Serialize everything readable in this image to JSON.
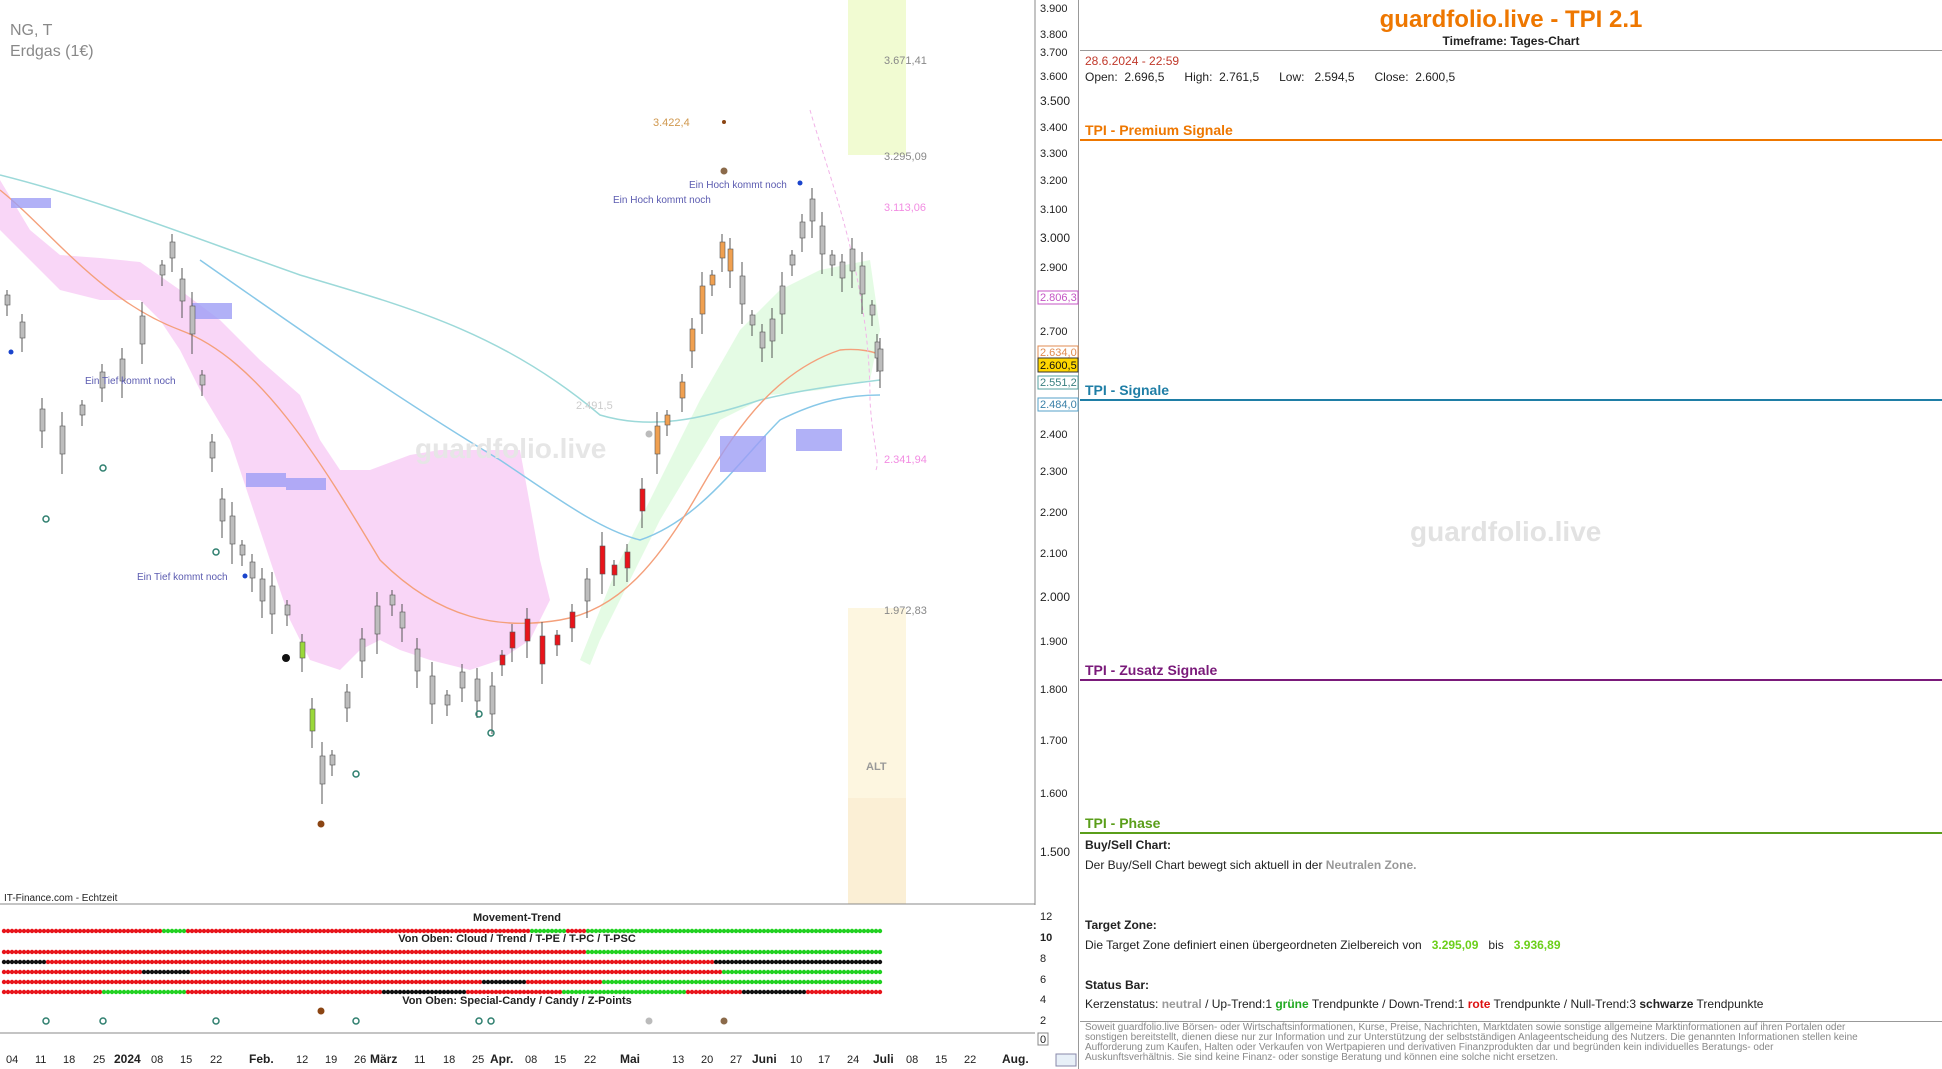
{
  "chart": {
    "symbol": "NG, T",
    "name": "Erdgas (1€)",
    "source": "IT-Finance.com - Echtzeit",
    "watermark": "guardfolio.live",
    "alt_label": "ALT",
    "price_labels": {
      "l3900": "3.900",
      "l3800": "3.800",
      "l3700": "3.700",
      "l3600": "3.600",
      "l3500": "3.500",
      "l3400": "3.400",
      "l3300": "3.300",
      "l3200": "3.200",
      "l3100": "3.100",
      "l3000": "3.000",
      "l2900": "2.900",
      "l2700": "2.700",
      "l2400": "2.400",
      "l2300": "2.300",
      "l2200": "2.200",
      "l2100": "2.100",
      "l2000": "2.000",
      "l1900": "1.900",
      "l1800": "1.800",
      "l1700": "1.700",
      "l1600": "1.600",
      "l1500": "1.500"
    },
    "price_tags": {
      "t1": "2.806,3",
      "t2": "2.634,0",
      "t3": "2.600,5",
      "t4": "2.551,2",
      "t5": "2.484,0"
    },
    "target_levels": {
      "z1": "3.671,41",
      "z2": "3.295,09",
      "z3": "3.113,06",
      "z4": "2.341,94",
      "z5": "1.972,83",
      "z6": "2.491,5",
      "z7": "3.422,4"
    },
    "annotations": {
      "hoch1": "Ein Hoch kommt noch",
      "hoch2": "Ein Hoch kommt noch",
      "tief1": "Ein Tief kommt noch",
      "tief2": "Ein Tief kommt noch"
    },
    "x_labels": {
      "a": "04",
      "b": "11",
      "c": "18",
      "d": "25",
      "e": "2024",
      "f": "08",
      "g": "15",
      "h": "22",
      "i": "Feb.",
      "j": "12",
      "k": "19",
      "l": "26",
      "m": "März",
      "n": "11",
      "o": "18",
      "p": "25",
      "q": "Apr.",
      "r": "08",
      "s": "15",
      "t": "22",
      "u": "Mai",
      "v": "13",
      "w": "20",
      "x": "27",
      "y": "Juni",
      "z": "10",
      "aa": "17",
      "ab": "24",
      "ac": "Juli",
      "ad": "08",
      "ae": "15",
      "af": "22",
      "ag": "Aug."
    },
    "indicator": {
      "title1": "Movement-Trend",
      "title2": "Von Oben: Cloud / Trend / T-PE / T-PC / T-PSC",
      "title3": "Von Oben: Special-Candy / Candy / Z-Points",
      "scale": {
        "s12": "12",
        "s10": "10",
        "s8": "8",
        "s6": "6",
        "s4": "4",
        "s2": "2",
        "s0": "0"
      }
    },
    "colors": {
      "red": "#e8141b",
      "green": "#21d121",
      "black": "#111111",
      "cloud": "#f5c6f5",
      "grey": "#bcbcbc"
    }
  },
  "panel": {
    "title": "guardfolio.live - TPI 2.1",
    "timeframe": "Timeframe: Tages-Chart",
    "datetime": "28.6.2024 - 22:59",
    "ohlc": "Open:  2.696,5      High:  2.761,5      Low:   2.594,5      Close:  2.600,5",
    "premium": "TPI - Premium Signale",
    "signale": "TPI - Signale",
    "zusatz": "TPI - Zusatz Signale",
    "phase": "TPI - Phase",
    "watermark": "guardfolio.live",
    "buysell_head": "Buy/Sell Chart:",
    "buysell_text": "Der Buy/Sell Chart bewegt sich aktuell in der",
    "buysell_zone": "Neutralen Zone.",
    "target_head": "Target Zone:",
    "target_text": "Die Target Zone definiert einen übergeordneten Zielbereich von",
    "target_from": "3.295,09",
    "target_bis": "bis",
    "target_to": "3.936,89",
    "status_head": "Status Bar:",
    "status": {
      "k": "Kerzenstatus:",
      "neutral": "neutral",
      "up": "/ Up-Trend:1",
      "gruene": "grüne",
      "tp1": "Trendpunkte",
      "down": "/ Down-Trend:1",
      "rote": "rote",
      "tp2": "Trendpunkte",
      "null": "/ Null-Trend:3",
      "schwarze": "schwarze",
      "tp3": "Trendpunkte"
    },
    "disclaimer": "Soweit guardfolio.live Börsen- oder Wirtschaftsinformationen, Kurse, Preise, Nachrichten, Marktdaten sowie sonstige allgemeine Marktinformationen auf ihren Portalen oder sonstigen bereitstellt, dienen diese nur zur Information und zur Unterstützung der selbstständigen Anlageentscheidung des Nutzers. Die genannten Informationen stellen keine Aufforderung zum Kaufen, Halten oder Verkaufen von Wertpapieren und derivativen Finanzprodukten dar und begründen kein individuelles Beratungs- oder Auskunftsverhältnis. Sie sind keine Finanz- oder sonstige Beratung und können eine solche nicht ersetzen."
  }
}
